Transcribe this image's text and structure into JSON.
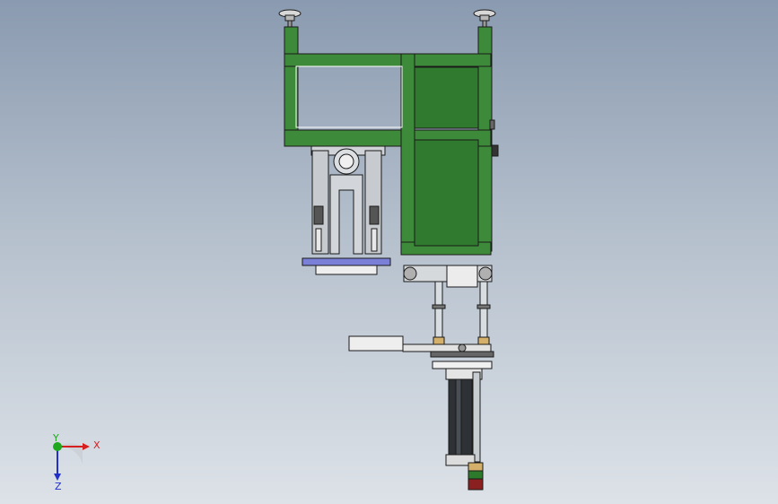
{
  "viewport": {
    "background_top": "#8a9ab0",
    "background_bottom": "#dde2e8"
  },
  "model": {
    "frame_color": "#3d8a3a",
    "steel_color": "#c8cdd2",
    "plate_color": "#7a7fd8",
    "cylinder_color": "#2e3236",
    "ring_colors": [
      "#d4b06a",
      "#2d7a2d",
      "#8a2020"
    ]
  },
  "triad": {
    "x_label": "X",
    "y_label": "Y",
    "z_label": "Z",
    "x_color": "#d62020",
    "y_color": "#1ea81e",
    "z_color": "#2030c8"
  }
}
